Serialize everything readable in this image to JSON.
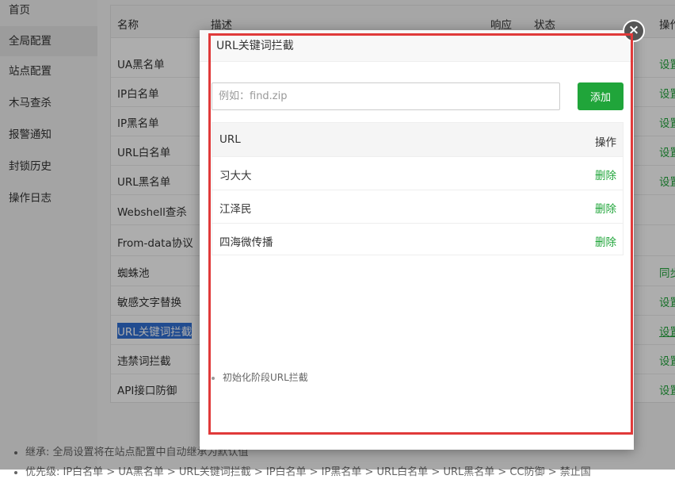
{
  "sidebar": {
    "items": [
      {
        "label": "首页"
      },
      {
        "label": "全局配置"
      },
      {
        "label": "站点配置"
      },
      {
        "label": "木马查杀"
      },
      {
        "label": "报警通知"
      },
      {
        "label": "封锁历史"
      },
      {
        "label": "操作日志"
      }
    ],
    "active_index": 1
  },
  "table": {
    "headers": {
      "name": "名称",
      "desc": "描述",
      "response": "响应",
      "status": "状态",
      "ops": "操作"
    },
    "rows": [
      {
        "name": "UA黑名单",
        "op": "设置"
      },
      {
        "name": "IP白名单",
        "op": "设置"
      },
      {
        "name": "IP黑名单",
        "op": "设置"
      },
      {
        "name": "URL白名单",
        "op": "设置"
      },
      {
        "name": "URL黑名单",
        "op": "设置"
      },
      {
        "name": "Webshell查杀",
        "op": ""
      },
      {
        "name": "From-data协议",
        "op": ""
      },
      {
        "name": "蜘蛛池",
        "op": "同步"
      },
      {
        "name": "敏感文字替换",
        "op": "设置"
      },
      {
        "name": "URL关键词拦截",
        "op": "设置",
        "selected": true
      },
      {
        "name": "违禁词拦截",
        "op": "设置"
      },
      {
        "name": "API接口防御",
        "op": "设置"
      }
    ]
  },
  "notes": [
    "继承: 全局设置将在站点配置中自动继承为默认值",
    "优先级: IP白名单 > UA黑名单 > URL关键词拦截 > IP白名单 > IP黑名单 > URL白名单 > URL黑名单 > CC防御 > 禁止国"
  ],
  "modal": {
    "title": "URL关键词拦截",
    "input_placeholder": "例如：find.zip",
    "input_value": "",
    "add_label": "添加",
    "table_headers": {
      "url": "URL",
      "ops": "操作"
    },
    "rows": [
      {
        "url": "习大大",
        "action": "删除"
      },
      {
        "url": "江泽民",
        "action": "删除"
      },
      {
        "url": "四海微传播",
        "action": "删除"
      }
    ],
    "hint": "初始化阶段URL拦截",
    "close_icon": "close-icon"
  },
  "colors": {
    "accent": "#20a53a",
    "selection": "#3270d5",
    "highlight_frame": "#e03a3a"
  }
}
